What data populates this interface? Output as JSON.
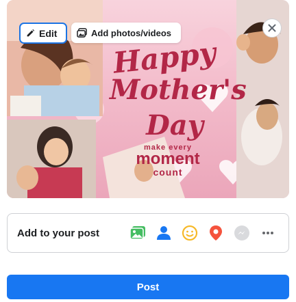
{
  "media": {
    "image_text": [
      "Happy",
      "Mother's",
      "Day",
      "make every",
      "moment",
      "count"
    ]
  },
  "overlay": {
    "edit_label": "Edit",
    "edit_icon": "pencil-icon",
    "add_media_label": "Add photos/videos",
    "add_media_icon": "photos-icon",
    "close_icon": "close-icon"
  },
  "add_to_post": {
    "label": "Add to your post",
    "tools": [
      {
        "name": "photo-video",
        "icon": "photo-video-icon",
        "color": "#45bd62"
      },
      {
        "name": "tag-people",
        "icon": "tag-people-icon",
        "color": "#1877f2"
      },
      {
        "name": "feeling-activity",
        "icon": "feeling-icon",
        "color": "#f7b928"
      },
      {
        "name": "check-in",
        "icon": "location-pin-icon",
        "color": "#f5533d"
      },
      {
        "name": "messenger",
        "icon": "messenger-icon",
        "color": "#d9dadd"
      },
      {
        "name": "more",
        "icon": "more-icon",
        "color": "#65676b"
      }
    ]
  },
  "post": {
    "label": "Post",
    "color": "#1877f2"
  }
}
